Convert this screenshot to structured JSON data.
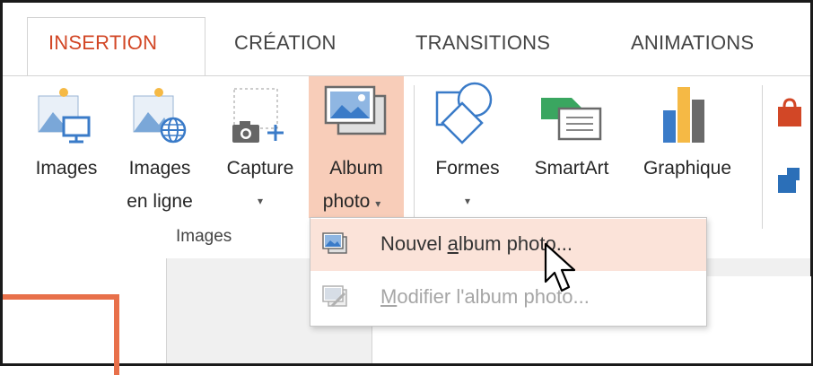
{
  "tabs": [
    {
      "label": "INSERTION",
      "active": true
    },
    {
      "label": "CRÉATION",
      "active": false
    },
    {
      "label": "TRANSITIONS",
      "active": false
    },
    {
      "label": "ANIMATIONS",
      "active": false
    }
  ],
  "ribbon": {
    "buttons": {
      "images": {
        "line1": "Images"
      },
      "images_online": {
        "line1": "Images",
        "line2": "en ligne"
      },
      "capture": {
        "line1": "Capture",
        "arrow": "▾"
      },
      "album": {
        "line1": "Album",
        "line2": "photo",
        "arrow": "▾",
        "highlighted": true
      },
      "shapes": {
        "line1": "Formes",
        "arrow": "▾"
      },
      "smartart": {
        "line1": "SmartArt"
      },
      "chart": {
        "line1": "Graphique"
      }
    },
    "group_label": "Images"
  },
  "dropdown_menu": {
    "items": [
      {
        "pre": "Nouvel ",
        "accel": "a",
        "post": "lbum photo...",
        "enabled": true,
        "hovered": true,
        "icon": "new-album-icon"
      },
      {
        "pre": "",
        "accel": "M",
        "post": "odifier l'album photo...",
        "enabled": false,
        "icon": "edit-album-icon"
      }
    ]
  },
  "colors": {
    "accent": "#d24726",
    "highlight": "#f8cdb9",
    "hover": "#fbe3d9",
    "slide_border": "#e8704a",
    "icon_blue": "#3a7bc8"
  }
}
